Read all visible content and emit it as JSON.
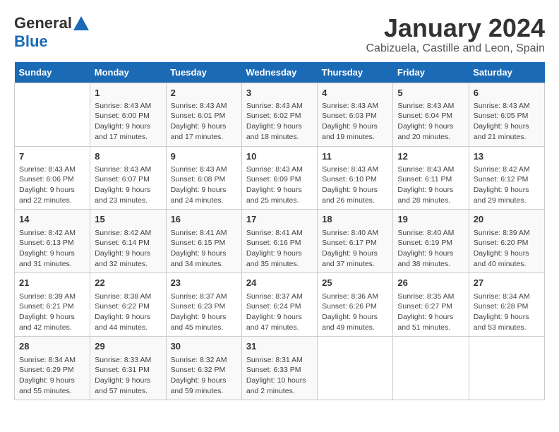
{
  "logo": {
    "line1": "General",
    "line2": "Blue"
  },
  "title": "January 2024",
  "subtitle": "Cabizuela, Castille and Leon, Spain",
  "weekdays": [
    "Sunday",
    "Monday",
    "Tuesday",
    "Wednesday",
    "Thursday",
    "Friday",
    "Saturday"
  ],
  "weeks": [
    [
      {
        "day": "",
        "sunrise": "",
        "sunset": "",
        "daylight": ""
      },
      {
        "day": "1",
        "sunrise": "Sunrise: 8:43 AM",
        "sunset": "Sunset: 6:00 PM",
        "daylight": "Daylight: 9 hours and 17 minutes."
      },
      {
        "day": "2",
        "sunrise": "Sunrise: 8:43 AM",
        "sunset": "Sunset: 6:01 PM",
        "daylight": "Daylight: 9 hours and 17 minutes."
      },
      {
        "day": "3",
        "sunrise": "Sunrise: 8:43 AM",
        "sunset": "Sunset: 6:02 PM",
        "daylight": "Daylight: 9 hours and 18 minutes."
      },
      {
        "day": "4",
        "sunrise": "Sunrise: 8:43 AM",
        "sunset": "Sunset: 6:03 PM",
        "daylight": "Daylight: 9 hours and 19 minutes."
      },
      {
        "day": "5",
        "sunrise": "Sunrise: 8:43 AM",
        "sunset": "Sunset: 6:04 PM",
        "daylight": "Daylight: 9 hours and 20 minutes."
      },
      {
        "day": "6",
        "sunrise": "Sunrise: 8:43 AM",
        "sunset": "Sunset: 6:05 PM",
        "daylight": "Daylight: 9 hours and 21 minutes."
      }
    ],
    [
      {
        "day": "7",
        "sunrise": "Sunrise: 8:43 AM",
        "sunset": "Sunset: 6:06 PM",
        "daylight": "Daylight: 9 hours and 22 minutes."
      },
      {
        "day": "8",
        "sunrise": "Sunrise: 8:43 AM",
        "sunset": "Sunset: 6:07 PM",
        "daylight": "Daylight: 9 hours and 23 minutes."
      },
      {
        "day": "9",
        "sunrise": "Sunrise: 8:43 AM",
        "sunset": "Sunset: 6:08 PM",
        "daylight": "Daylight: 9 hours and 24 minutes."
      },
      {
        "day": "10",
        "sunrise": "Sunrise: 8:43 AM",
        "sunset": "Sunset: 6:09 PM",
        "daylight": "Daylight: 9 hours and 25 minutes."
      },
      {
        "day": "11",
        "sunrise": "Sunrise: 8:43 AM",
        "sunset": "Sunset: 6:10 PM",
        "daylight": "Daylight: 9 hours and 26 minutes."
      },
      {
        "day": "12",
        "sunrise": "Sunrise: 8:43 AM",
        "sunset": "Sunset: 6:11 PM",
        "daylight": "Daylight: 9 hours and 28 minutes."
      },
      {
        "day": "13",
        "sunrise": "Sunrise: 8:42 AM",
        "sunset": "Sunset: 6:12 PM",
        "daylight": "Daylight: 9 hours and 29 minutes."
      }
    ],
    [
      {
        "day": "14",
        "sunrise": "Sunrise: 8:42 AM",
        "sunset": "Sunset: 6:13 PM",
        "daylight": "Daylight: 9 hours and 31 minutes."
      },
      {
        "day": "15",
        "sunrise": "Sunrise: 8:42 AM",
        "sunset": "Sunset: 6:14 PM",
        "daylight": "Daylight: 9 hours and 32 minutes."
      },
      {
        "day": "16",
        "sunrise": "Sunrise: 8:41 AM",
        "sunset": "Sunset: 6:15 PM",
        "daylight": "Daylight: 9 hours and 34 minutes."
      },
      {
        "day": "17",
        "sunrise": "Sunrise: 8:41 AM",
        "sunset": "Sunset: 6:16 PM",
        "daylight": "Daylight: 9 hours and 35 minutes."
      },
      {
        "day": "18",
        "sunrise": "Sunrise: 8:40 AM",
        "sunset": "Sunset: 6:17 PM",
        "daylight": "Daylight: 9 hours and 37 minutes."
      },
      {
        "day": "19",
        "sunrise": "Sunrise: 8:40 AM",
        "sunset": "Sunset: 6:19 PM",
        "daylight": "Daylight: 9 hours and 38 minutes."
      },
      {
        "day": "20",
        "sunrise": "Sunrise: 8:39 AM",
        "sunset": "Sunset: 6:20 PM",
        "daylight": "Daylight: 9 hours and 40 minutes."
      }
    ],
    [
      {
        "day": "21",
        "sunrise": "Sunrise: 8:39 AM",
        "sunset": "Sunset: 6:21 PM",
        "daylight": "Daylight: 9 hours and 42 minutes."
      },
      {
        "day": "22",
        "sunrise": "Sunrise: 8:38 AM",
        "sunset": "Sunset: 6:22 PM",
        "daylight": "Daylight: 9 hours and 44 minutes."
      },
      {
        "day": "23",
        "sunrise": "Sunrise: 8:37 AM",
        "sunset": "Sunset: 6:23 PM",
        "daylight": "Daylight: 9 hours and 45 minutes."
      },
      {
        "day": "24",
        "sunrise": "Sunrise: 8:37 AM",
        "sunset": "Sunset: 6:24 PM",
        "daylight": "Daylight: 9 hours and 47 minutes."
      },
      {
        "day": "25",
        "sunrise": "Sunrise: 8:36 AM",
        "sunset": "Sunset: 6:26 PM",
        "daylight": "Daylight: 9 hours and 49 minutes."
      },
      {
        "day": "26",
        "sunrise": "Sunrise: 8:35 AM",
        "sunset": "Sunset: 6:27 PM",
        "daylight": "Daylight: 9 hours and 51 minutes."
      },
      {
        "day": "27",
        "sunrise": "Sunrise: 8:34 AM",
        "sunset": "Sunset: 6:28 PM",
        "daylight": "Daylight: 9 hours and 53 minutes."
      }
    ],
    [
      {
        "day": "28",
        "sunrise": "Sunrise: 8:34 AM",
        "sunset": "Sunset: 6:29 PM",
        "daylight": "Daylight: 9 hours and 55 minutes."
      },
      {
        "day": "29",
        "sunrise": "Sunrise: 8:33 AM",
        "sunset": "Sunset: 6:31 PM",
        "daylight": "Daylight: 9 hours and 57 minutes."
      },
      {
        "day": "30",
        "sunrise": "Sunrise: 8:32 AM",
        "sunset": "Sunset: 6:32 PM",
        "daylight": "Daylight: 9 hours and 59 minutes."
      },
      {
        "day": "31",
        "sunrise": "Sunrise: 8:31 AM",
        "sunset": "Sunset: 6:33 PM",
        "daylight": "Daylight: 10 hours and 2 minutes."
      },
      {
        "day": "",
        "sunrise": "",
        "sunset": "",
        "daylight": ""
      },
      {
        "day": "",
        "sunrise": "",
        "sunset": "",
        "daylight": ""
      },
      {
        "day": "",
        "sunrise": "",
        "sunset": "",
        "daylight": ""
      }
    ]
  ]
}
